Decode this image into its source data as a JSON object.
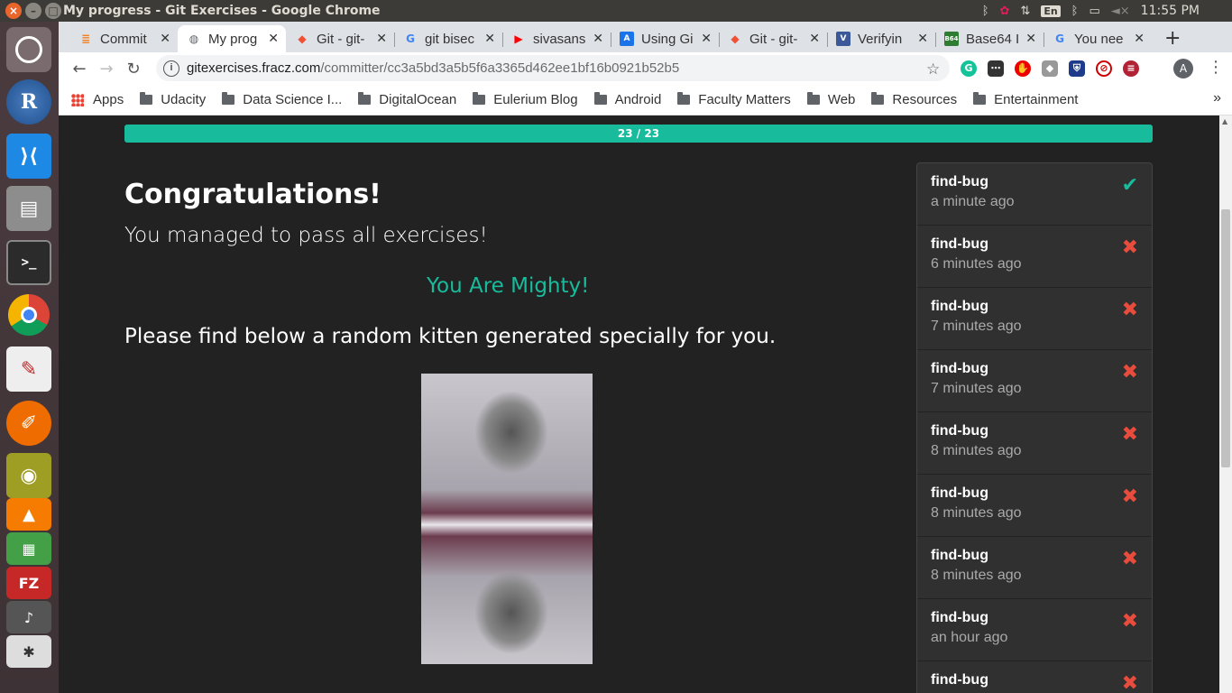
{
  "os": {
    "window_title": "My progress - Git Exercises - Google Chrome",
    "tray": {
      "lang": "En",
      "clock": "11:55 PM"
    }
  },
  "browser": {
    "tabs": [
      {
        "label": "Commit",
        "favicon": "stackoverflow-icon",
        "color": "#f48024"
      },
      {
        "label": "My prog",
        "favicon": "globe-icon",
        "color": "#5f6368",
        "active": true
      },
      {
        "label": "Git - git-",
        "favicon": "git-icon",
        "color": "#f05033"
      },
      {
        "label": "git bisec",
        "favicon": "google-icon",
        "color": "#4285f4"
      },
      {
        "label": "sivasans",
        "favicon": "youtube-icon",
        "color": "#ff0000"
      },
      {
        "label": "Using Gi",
        "favicon": "appveyor-icon",
        "color": "#1a73e8"
      },
      {
        "label": "Git - git-",
        "favicon": "git-icon",
        "color": "#f05033"
      },
      {
        "label": "Verifyin",
        "favicon": "doc-icon",
        "color": "#3b5998"
      },
      {
        "label": "Base64 I",
        "favicon": "b64-icon",
        "color": "#2e7d32"
      },
      {
        "label": "You nee",
        "favicon": "google-icon",
        "color": "#4285f4"
      }
    ],
    "url_host": "gitexercises.fracz.com",
    "url_path": "/committer/cc3a5bd3a5b5f6a3365d462ee1bf16b0921b52b5",
    "profile_initial": "A",
    "bookmarks": [
      {
        "label": "Apps",
        "type": "apps"
      },
      {
        "label": "Udacity",
        "type": "folder"
      },
      {
        "label": "Data Science I...",
        "type": "folder"
      },
      {
        "label": "DigitalOcean",
        "type": "folder"
      },
      {
        "label": "Eulerium Blog",
        "type": "folder"
      },
      {
        "label": "Android",
        "type": "folder"
      },
      {
        "label": "Faculty Matters",
        "type": "folder"
      },
      {
        "label": "Web",
        "type": "folder"
      },
      {
        "label": "Resources",
        "type": "folder"
      },
      {
        "label": "Entertainment",
        "type": "folder"
      }
    ],
    "bookmarks_more": "»"
  },
  "page": {
    "progress": {
      "text": "23 / 23",
      "value": 23,
      "max": 23
    },
    "heading": "Congratulations!",
    "subheading": "You managed to pass all exercises!",
    "mighty": "You Are Mighty!",
    "kitten_text": "Please find below a random kitten generated specially for you.",
    "attempts": [
      {
        "name": "find-bug",
        "time": "a minute ago",
        "status": "pass"
      },
      {
        "name": "find-bug",
        "time": "6 minutes ago",
        "status": "fail"
      },
      {
        "name": "find-bug",
        "time": "7 minutes ago",
        "status": "fail"
      },
      {
        "name": "find-bug",
        "time": "7 minutes ago",
        "status": "fail"
      },
      {
        "name": "find-bug",
        "time": "8 minutes ago",
        "status": "fail"
      },
      {
        "name": "find-bug",
        "time": "8 minutes ago",
        "status": "fail"
      },
      {
        "name": "find-bug",
        "time": "8 minutes ago",
        "status": "fail"
      },
      {
        "name": "find-bug",
        "time": "an hour ago",
        "status": "fail"
      },
      {
        "name": "find-bug",
        "time": "",
        "status": "fail"
      }
    ]
  },
  "colors": {
    "accent": "#18bc9c",
    "fail": "#e74c3c",
    "background": "#222222"
  }
}
